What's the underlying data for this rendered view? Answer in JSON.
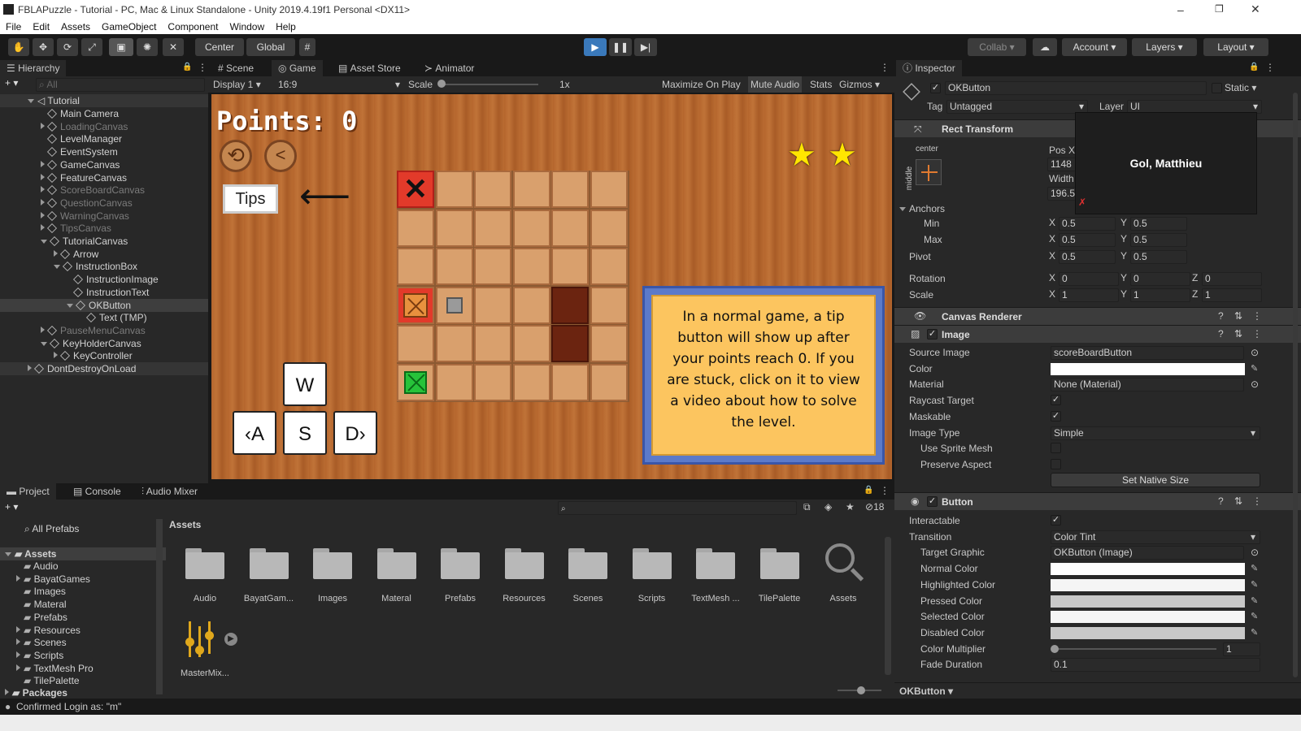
{
  "window": {
    "title": "FBLAPuzzle - Tutorial - PC, Mac & Linux Standalone - Unity 2019.4.19f1 Personal <DX11>",
    "minimize": "–",
    "maximize": "❐",
    "close": "✕"
  },
  "menu": [
    "File",
    "Edit",
    "Assets",
    "GameObject",
    "Component",
    "Window",
    "Help"
  ],
  "toolbar": {
    "pivot": "Center",
    "space": "Global",
    "collab": "Collab",
    "account": "Account",
    "layers": "Layers",
    "layout": "Layout"
  },
  "hierarchy": {
    "tab": "Hierarchy",
    "search_placeholder": "All",
    "scene": "Tutorial",
    "items": [
      "Main Camera",
      "LoadingCanvas",
      "LevelManager",
      "EventSystem",
      "GameCanvas",
      "FeatureCanvas",
      "ScoreBoardCanvas",
      "QuestionCanvas",
      "WarningCanvas",
      "TipsCanvas",
      "TutorialCanvas",
      "Arrow",
      "InstructionBox",
      "InstructionImage",
      "InstructionText",
      "OKButton",
      "Text (TMP)",
      "PauseMenuCanvas",
      "KeyHolderCanvas",
      "KeyController",
      "DontDestroyOnLoad"
    ]
  },
  "center_tabs": [
    "Scene",
    "Game",
    "Asset Store",
    "Animator"
  ],
  "game_bar": {
    "display": "Display 1",
    "aspect": "16:9",
    "scale_label": "Scale",
    "scale_value": "1x",
    "maximize": "Maximize On Play",
    "mute": "Mute Audio",
    "stats": "Stats",
    "gizmos": "Gizmos"
  },
  "game": {
    "points": "Points: 0",
    "tips": "Tips",
    "keys": {
      "w": "W",
      "a": "A",
      "s": "S",
      "d": "D"
    },
    "instruction": "In a normal game, a tip button will show up after your points reach 0. If you are stuck, click on it to view a video about how to solve the level.",
    "stars": 2
  },
  "bottom_tabs": [
    "Project",
    "Console",
    "Audio Mixer"
  ],
  "project": {
    "favorites": "All Prefabs",
    "assets_root": "Assets",
    "tree": [
      "Audio",
      "BayatGames",
      "Images",
      "Materal",
      "Prefabs",
      "Resources",
      "Scenes",
      "Scripts",
      "TextMesh Pro",
      "TilePalette"
    ],
    "packages": "Packages",
    "breadcrumb": "Assets",
    "hidden_count": "18",
    "folders": [
      "Audio",
      "BayatGam...",
      "Images",
      "Materal",
      "Prefabs",
      "Resources",
      "Scenes",
      "Scripts",
      "TextMesh ...",
      "TilePalette",
      "Assets"
    ],
    "mixer": "MasterMix..."
  },
  "status": "Confirmed Login as: \"m\"",
  "inspector": {
    "tab": "Inspector",
    "object_name": "OKButton",
    "static": "Static",
    "tag_label": "Tag",
    "tag": "Untagged",
    "layer_label": "Layer",
    "layer": "UI",
    "tooltip": "Gol, Matthieu",
    "rect": {
      "title": "Rect Transform",
      "anchor_h": "center",
      "anchor_v": "middle",
      "posx_label": "Pos X",
      "posx": "1148",
      "width_label": "Width",
      "width": "196.5"
    },
    "anchors_label": "Anchors",
    "min_label": "Min",
    "max_label": "Max",
    "pivot_label": "Pivot",
    "rotation_label": "Rotation",
    "scale_label": "Scale",
    "min": [
      "0.5",
      "0.5"
    ],
    "max": [
      "0.5",
      "0.5"
    ],
    "pivot": [
      "0.5",
      "0.5"
    ],
    "rotation": [
      "0",
      "0",
      "0"
    ],
    "scale": [
      "1",
      "1",
      "1"
    ],
    "canvas_renderer": "Canvas Renderer",
    "image": {
      "title": "Image",
      "rows": [
        [
          "Source Image",
          "scoreBoardButton"
        ],
        [
          "Color",
          ""
        ],
        [
          "Material",
          "None (Material)"
        ],
        [
          "Raycast Target",
          "✓"
        ],
        [
          "Maskable",
          "✓"
        ],
        [
          "Image Type",
          "Simple"
        ],
        [
          "Use Sprite Mesh",
          ""
        ],
        [
          "Preserve Aspect",
          ""
        ]
      ],
      "native": "Set Native Size"
    },
    "button": {
      "title": "Button",
      "rows": [
        [
          "Interactable",
          "✓"
        ],
        [
          "Transition",
          "Color Tint"
        ],
        [
          "Target Graphic",
          "OKButton (Image)"
        ],
        [
          "Normal Color",
          ""
        ],
        [
          "Highlighted Color",
          ""
        ],
        [
          "Pressed Color",
          ""
        ],
        [
          "Selected Color",
          ""
        ],
        [
          "Disabled Color",
          ""
        ],
        [
          "Color Multiplier",
          "1"
        ],
        [
          "Fade Duration",
          "0.1"
        ]
      ]
    },
    "footer": "OKButton"
  },
  "colors": {
    "accent": "#3a79bb",
    "selected": "#3e3e3e",
    "wood": "#b5662d"
  }
}
